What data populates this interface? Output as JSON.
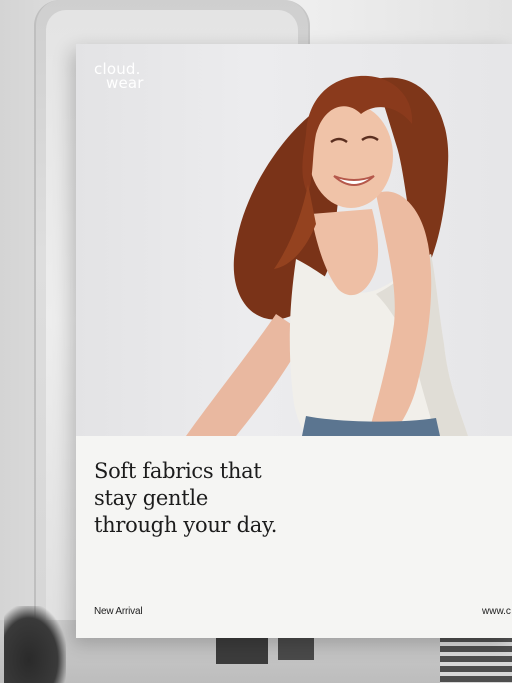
{
  "brand": {
    "logo_line1": "cloud.",
    "logo_line2": "wear"
  },
  "ad": {
    "headline_lines": [
      "Soft fabrics that",
      "stay gentle",
      "through your day."
    ],
    "tagline": "New Arrival",
    "url": "www.c"
  },
  "colors": {
    "panel_bg": "#f5f5f3",
    "headline": "#1c1c1c",
    "logo": "#ffffff",
    "photo_bg": "#e8e8ea",
    "hair": "#8a3a1c",
    "top": "#f1efea"
  }
}
